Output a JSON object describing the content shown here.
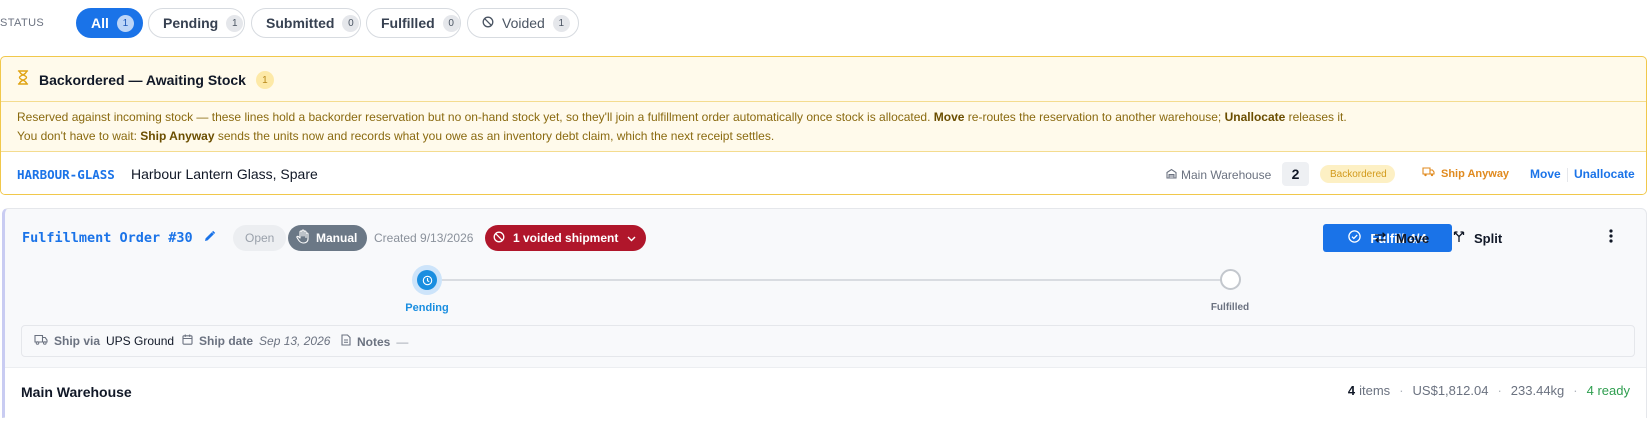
{
  "status_filter": {
    "label": "STATUS",
    "pills": [
      {
        "label": "All",
        "count": "1"
      },
      {
        "label": "Pending",
        "count": "1"
      },
      {
        "label": "Submitted",
        "count": "0"
      },
      {
        "label": "Fulfilled",
        "count": "0"
      },
      {
        "label": "Voided",
        "count": "1"
      }
    ]
  },
  "backorder": {
    "title": "Backordered — Awaiting Stock",
    "count": "1",
    "desc1_pre": "Reserved against incoming stock — these lines hold a backorder reservation but no on-hand stock yet, so they'll join a fulfillment order automatically once stock is allocated. ",
    "desc1_move": "Move",
    "desc1_mid": " re-routes the reservation to another warehouse; ",
    "desc1_unalloc": "Unallocate",
    "desc1_post": " releases it.",
    "desc2_pre": "You don't have to wait: ",
    "desc2_ship": "Ship Anyway",
    "desc2_post": " sends the units now and records what you owe as an inventory debt claim, which the next receipt settles.",
    "line": {
      "sku": "HARBOUR-GLASS",
      "product": "Harbour Lantern Glass, Spare",
      "warehouse": "Main Warehouse",
      "qty": "2",
      "badge": "Backordered",
      "ship_anyway": "Ship Anyway",
      "move": "Move",
      "unallocate": "Unallocate"
    }
  },
  "fulfillment_order": {
    "title": "Fulfillment Order #30",
    "state": "Open",
    "mode": "Manual",
    "created": "Created 9/13/2026",
    "voided_chip": "1 voided shipment",
    "fulfill_button": "Fulfill 4/4",
    "move_button": "Move",
    "split_button": "Split",
    "steps": [
      {
        "label": "Pending"
      },
      {
        "label": "Fulfilled"
      }
    ],
    "ship_via_key": "Ship via",
    "ship_via_value": "UPS Ground",
    "ship_date_key": "Ship date",
    "ship_date_value": "Sep 13, 2026",
    "notes_key": "Notes",
    "notes_value": "—",
    "warehouse": {
      "name": "Main Warehouse",
      "items_count": "4",
      "items_label": "items",
      "total": "US$1,812.04",
      "weight": "233.44kg",
      "ready": "4 ready",
      "dot": "·"
    }
  },
  "colors": {
    "accent": "#1a73e8",
    "warning_border": "#f1c84b",
    "voided": "#b0162b",
    "ready": "#2e9e4f"
  }
}
